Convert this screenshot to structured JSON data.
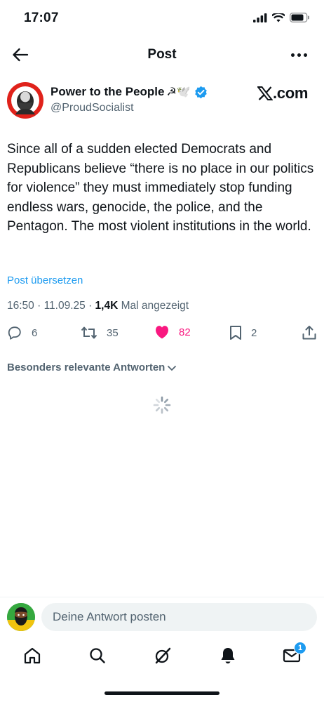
{
  "status_bar": {
    "time": "17:07"
  },
  "nav": {
    "title": "Post"
  },
  "author": {
    "display_name": "Power to the People",
    "name_emojis": "☭🕊️",
    "handle": "@ProudSocialist",
    "brand": ".com"
  },
  "post": {
    "text": "Since all of a sudden elected Democrats and Republicans believe “there is no place in our politics for violence” they must immediately stop funding endless wars, genocide, the police, and the Pentagon. The most violent institutions in the world.",
    "translate_label": "Post übersetzen",
    "time": "16:50",
    "date": "11.09.25",
    "views": "1,4K",
    "views_label": "Mal angezeigt"
  },
  "actions": {
    "replies": "6",
    "reposts": "35",
    "likes": "82",
    "bookmarks": "2"
  },
  "replies_sort": {
    "label": "Besonders relevante Antworten"
  },
  "reply_box": {
    "placeholder": "Deine Antwort posten"
  },
  "tab_bar": {
    "messages_badge": "1"
  },
  "colors": {
    "accent": "#1d9bf0",
    "like": "#f91880",
    "text": "#0f1419",
    "secondary": "#536471"
  }
}
